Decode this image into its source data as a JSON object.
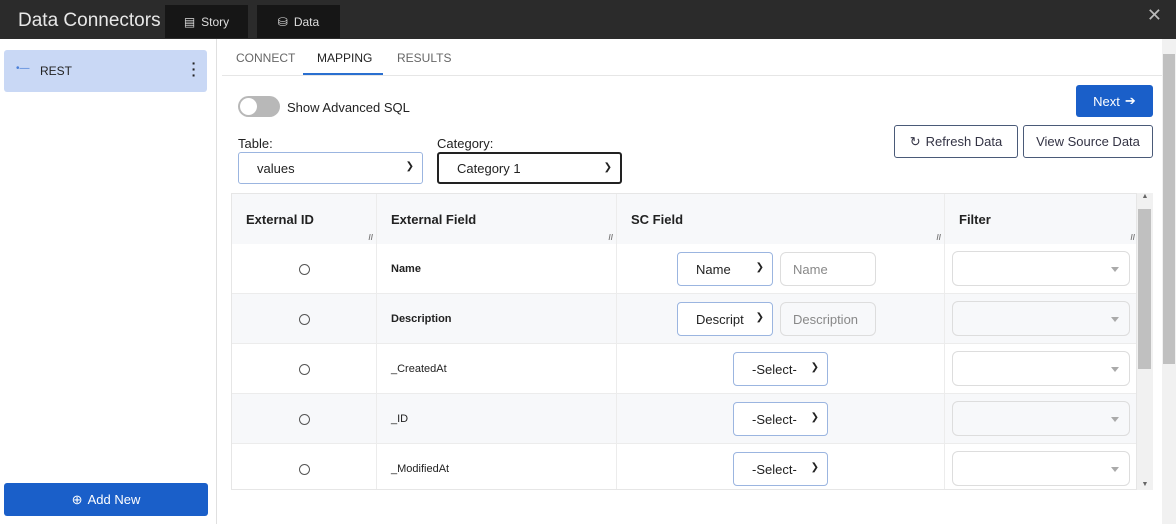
{
  "app": {
    "title": "Data Connectors",
    "tabs": [
      {
        "label": "Story",
        "icon": "book-icon"
      },
      {
        "label": "Data",
        "icon": "database-icon"
      }
    ]
  },
  "sidebar": {
    "items": [
      {
        "label": "REST"
      }
    ],
    "add_new": "Add New"
  },
  "tabs": [
    "CONNECT",
    "MAPPING",
    "RESULTS"
  ],
  "toggle": {
    "label": "Show Advanced SQL",
    "on": false
  },
  "table_select": {
    "label": "Table:",
    "value": "values"
  },
  "category_select": {
    "label": "Category:",
    "value": "Category 1"
  },
  "buttons": {
    "next": "Next",
    "refresh": "Refresh Data",
    "view_source": "View Source Data"
  },
  "grid": {
    "headers": [
      "External ID",
      "External Field",
      "SC Field",
      "Filter"
    ],
    "rows": [
      {
        "field": "Name",
        "bold": true,
        "sc_select": "Name",
        "sc_input_placeholder": "Name"
      },
      {
        "field": "Description",
        "bold": true,
        "sc_select": "Descript",
        "sc_input_placeholder": "Description"
      },
      {
        "field": "_CreatedAt",
        "bold": false,
        "sc_select": "-Select-"
      },
      {
        "field": "_ID",
        "bold": false,
        "sc_select": "-Select-"
      },
      {
        "field": "_ModifiedAt",
        "bold": false,
        "sc_select": "-Select-"
      }
    ]
  }
}
